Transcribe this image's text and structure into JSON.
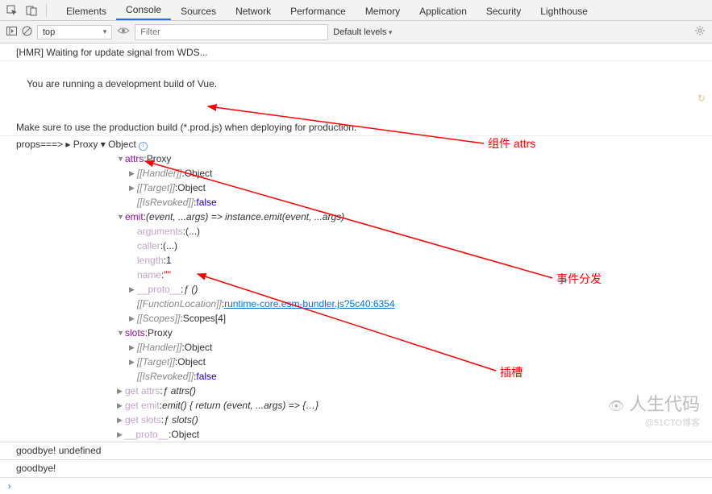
{
  "toolbar": {
    "tabs": [
      "Elements",
      "Console",
      "Sources",
      "Network",
      "Performance",
      "Memory",
      "Application",
      "Security",
      "Lighthouse"
    ],
    "activeTab": 1
  },
  "subbar": {
    "context": "top",
    "filterPlaceholder": "Filter",
    "levels": "Default levels"
  },
  "messages": {
    "hmr": "[HMR] Waiting for update signal from WDS...",
    "dev1": "You are running a development build of Vue.",
    "dev2": "Make sure to use the production build (*.prod.js) when deploying for production.",
    "propsLine": "props===> ▸ Proxy ▾ Object"
  },
  "tree": {
    "attrs": {
      "label": "attrs",
      "val": "Proxy",
      "handler": "Object",
      "target": "Object",
      "revoked": "false"
    },
    "emit": {
      "label": "emit",
      "sig": "(event, ...args) => instance.emit(event, ...args)",
      "arguments": "(...)",
      "caller": "(...)",
      "length": 1,
      "name": "\"\"",
      "proto": "ƒ ()",
      "funcLoc": "runtime-core.esm-bundler.js?5c40:6354",
      "scopes": "Scopes[4]"
    },
    "slots": {
      "label": "slots",
      "val": "Proxy",
      "handler": "Object",
      "target": "Object",
      "revoked": "false"
    },
    "getters": {
      "getAttrs": "ƒ attrs()",
      "getEmit": "emit() { return (event, ...args) => {…}",
      "getSlots": "ƒ slots()",
      "proto": "Object"
    }
  },
  "bottom": {
    "line1": "goodbye! undefined",
    "line2": "goodbye!"
  },
  "annotations": {
    "a1": "组件 attrs",
    "a2": "事件分发",
    "a3": "插槽"
  },
  "watermark": {
    "title": "人生代码",
    "sub": "@51CTO博客"
  }
}
